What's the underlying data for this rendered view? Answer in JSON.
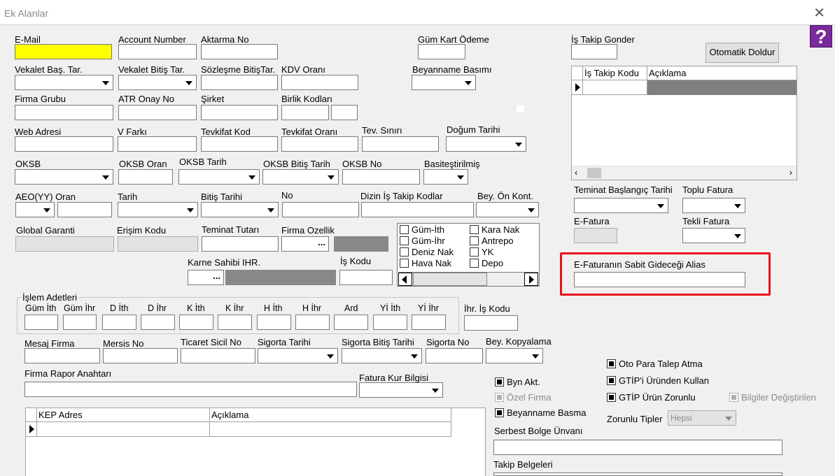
{
  "window": {
    "title": "Ek Alanlar"
  },
  "labels": {
    "email": "E-Mail",
    "account_number": "Account Number",
    "aktarma_no": "Aktarma No",
    "gum_kart_odeme": "Güm Kart Ödeme",
    "is_takip_gonder": "İş Takip Gonder",
    "vekalet_bas": "Vekalet Baş. Tar.",
    "vekalet_bitis": "Vekalet Bitiş Tar.",
    "sozlesme_bitis": "Sözleşme BitişTar.",
    "kdv_orani": "KDV Oranı",
    "beyanname_basimi": "Beyanname Basımı",
    "firma_grubu": "Firma Grubu",
    "atr_onay_no": "ATR Onay No",
    "sirket": "Şirket",
    "birlik_kodlari": "Birlik Kodları",
    "web_adresi": "Web Adresi",
    "v_farki": "V Farkı",
    "tevkifat_kod": "Tevkifat Kod",
    "tevkifat_orani": "Tevkifat Oranı",
    "tev_siniri": "Tev. Sınırı",
    "dogum_tarihi": "Doğum Tarihi",
    "oksb": "OKSB",
    "oksb_oran": "OKSB Oran",
    "oksb_tarih": "OKSB Tarih",
    "oksb_bitis_tarih": "OKSB Bitiş Tarih",
    "oksb_no": "OKSB No",
    "basitestirilmis": "Basiteştirilmiş",
    "aeo_oran": "AEO(YY) Oran",
    "tarih": "Tarih",
    "bitis_tarihi": "Bitiş Tarihi",
    "no": "No",
    "dizin_is_takip": "Dizin İş Takip Kodlar",
    "bey_on_kont": "Bey. Ön Kont.",
    "global_garanti": "Global Garanti",
    "erisim_kodu": "Erişim Kodu",
    "teminat_tutari": "Teminat Tutarı",
    "firma_ozellik": "Firma Ozellik",
    "karne_sahibi": "Karne Sahibi IHR.",
    "is_kodu": "İş Kodu",
    "islem_adetleri": "İşlem Adetleri",
    "ihr_is_kodu": "İhr. İş Kodu",
    "mesaj_firma": "Mesaj Firma",
    "mersis_no": "Mersis No",
    "ticaret_sicil": "Ticaret Sicil No",
    "sigorta_tarihi": "Sigorta Tarihi",
    "sigorta_bitis": "Sigorta Bitiş Tarihi",
    "sigorta_no": "Sigorta No",
    "bey_kopyalama": "Bey. Kopyalama",
    "firma_rapor": "Firma Rapor Anahtarı",
    "fatura_kur": "Fatura Kur Bilgisi",
    "teminat_baslangic": "Teminat Başlangıç Tarihi",
    "toplu_fatura": "Toplu Fatura",
    "e_fatura": "E-Fatura",
    "tekli_fatura": "Tekli Fatura",
    "e_fatura_alias": "E-Faturanın Sabit Gideceği Alias",
    "serbest_bolge": "Serbest Bolge Ünvanı",
    "takip_belgeleri": "Takip Belgeleri",
    "zorunlu_tipler": "Zorunlu Tipler"
  },
  "islem_columns": [
    "Güm İth",
    "Güm İhr",
    "D İth",
    "D İhr",
    "K İth",
    "K İhr",
    "H İth",
    "H İhr",
    "Ard",
    "Yİ İth",
    "Yİ İhr"
  ],
  "transport_checks": {
    "col1": [
      "Güm-İth",
      "Güm-İhr",
      "Deniz Nak",
      "Hava Nak"
    ],
    "col2": [
      "Kara Nak",
      "Antrepo",
      "YK",
      "Depo"
    ]
  },
  "buttons": {
    "otomatik_doldur": "Otomatik Doldur",
    "ellipsis": "..."
  },
  "is_takip_grid": {
    "columns": [
      "İş Takip Kodu",
      "Açıklama"
    ]
  },
  "kep_grid": {
    "columns": [
      "KEP Adres",
      "Açıklama"
    ]
  },
  "checks": {
    "oto_para": "Oto Para Talep Atma",
    "gtip_urun_kullan": "GTİP'i Üründen Kullan",
    "gtip_urun_zorunlu": "GTİP Ürün Zorunlu",
    "bilgiler_degistirilen": "Bilgiler Değiştirilen",
    "byn_akt": "Byn Akt.",
    "ozel_firma": "Özel Firma",
    "beyanname_basma": "Beyanname Basma"
  },
  "zorunlu_tipler_value": "Hepsi",
  "help_icon": "?"
}
